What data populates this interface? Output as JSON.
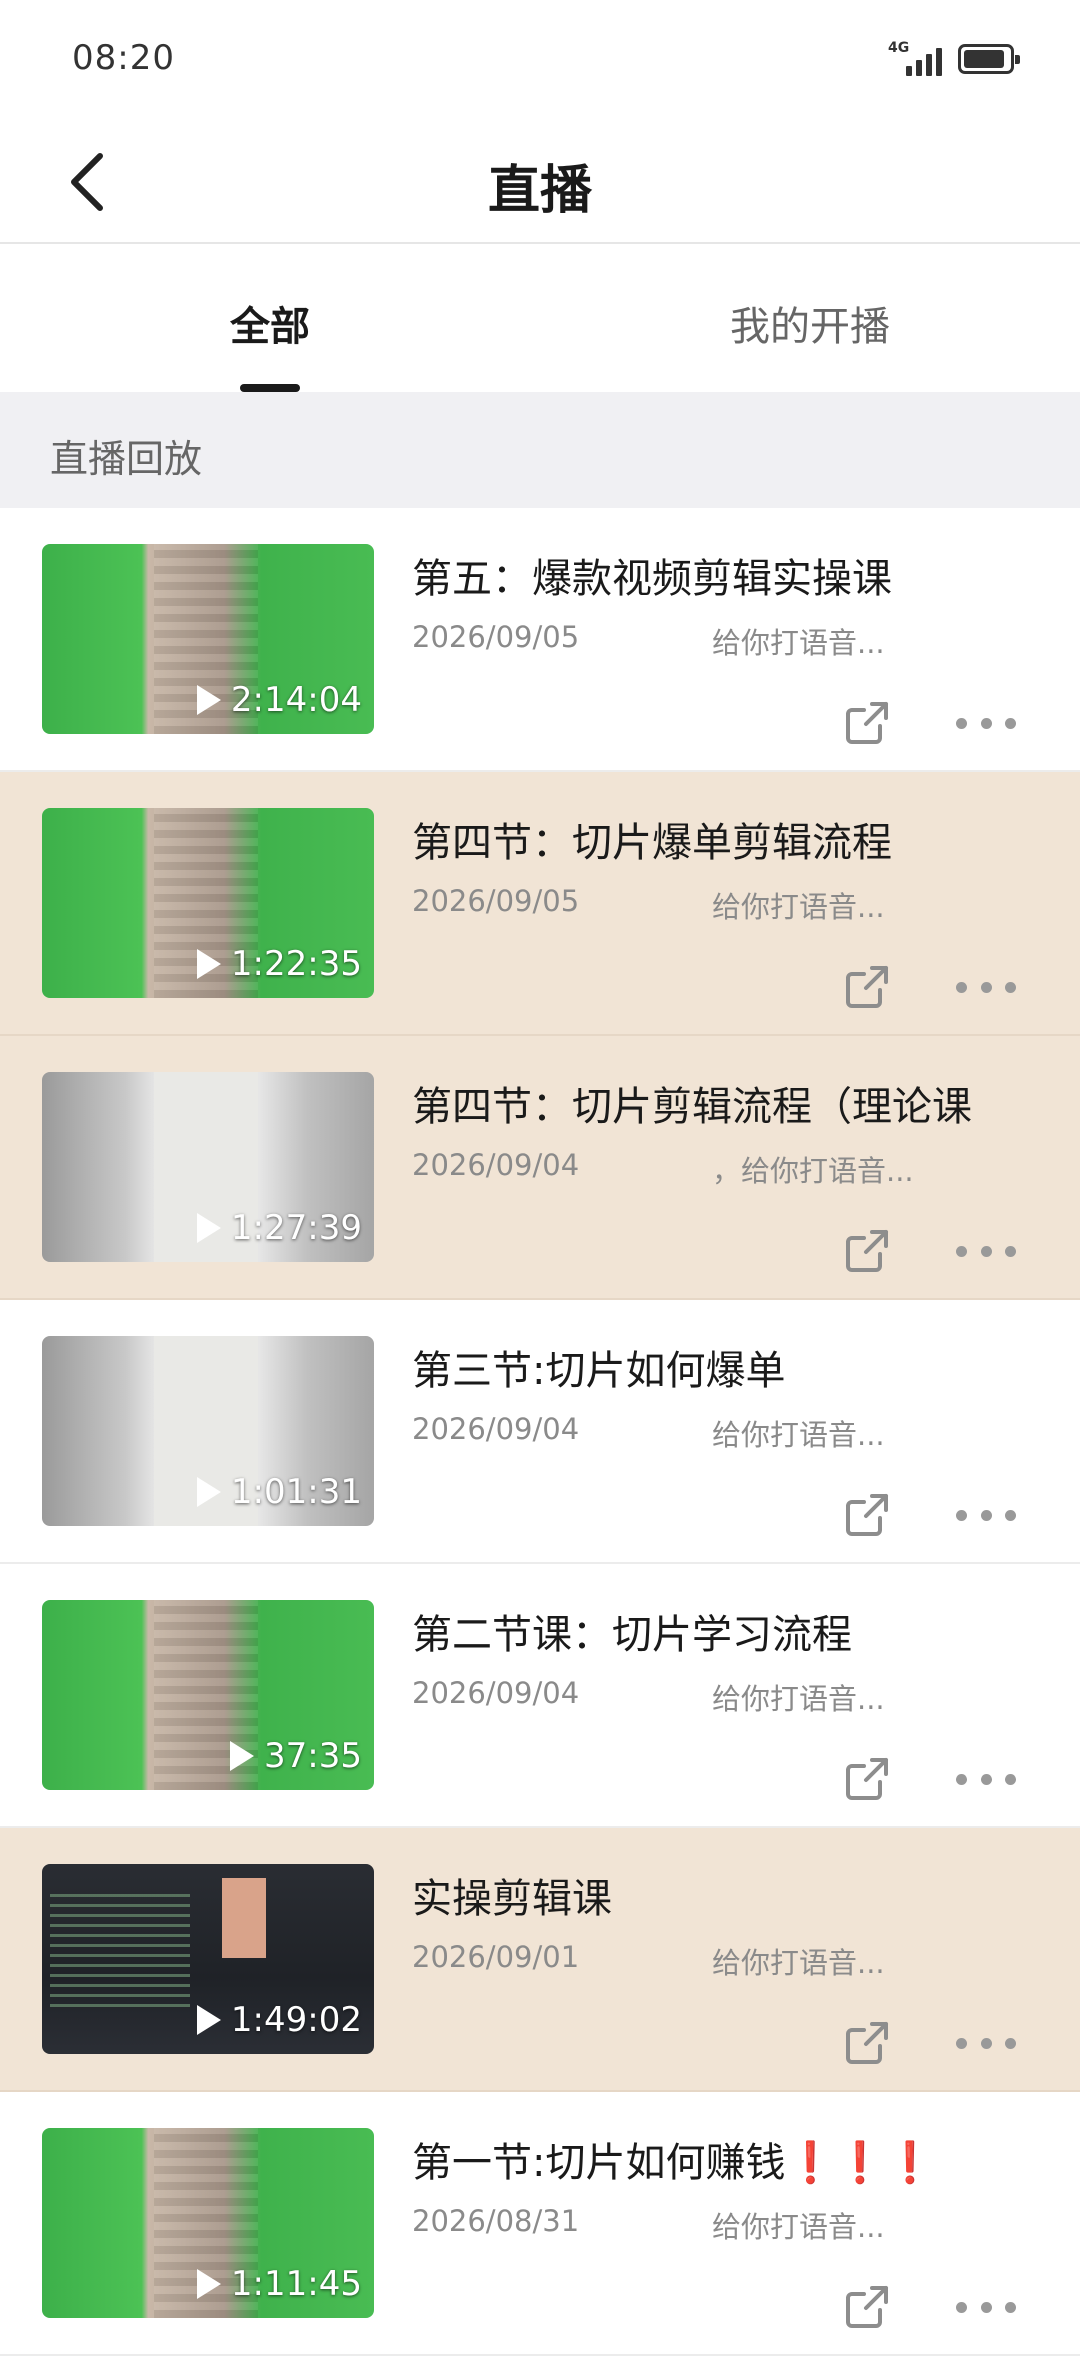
{
  "status_bar": {
    "time": "08:20",
    "network": "4G",
    "battery_level": 0.9
  },
  "header": {
    "title": "直播",
    "back_icon": "chevron-left-icon"
  },
  "tabs": [
    {
      "label": "全部",
      "active": true
    },
    {
      "label": "我的开播",
      "active": false
    }
  ],
  "section": {
    "title": "直播回放"
  },
  "items": [
    {
      "title": "第五：爆款视频剪辑实操课",
      "date": "2026/09/05",
      "host": "给你打语音...",
      "duration": "2:14:04",
      "thumb": "green",
      "highlight": false
    },
    {
      "title": "第四节：切片爆单剪辑流程",
      "date": "2026/09/05",
      "host": "给你打语音...",
      "duration": "1:22:35",
      "thumb": "green",
      "highlight": true
    },
    {
      "title": "第四节：切片剪辑流程（理论课",
      "date": "2026/09/04",
      "host": "，给你打语音...",
      "duration": "1:27:39",
      "thumb": "gray",
      "highlight": true
    },
    {
      "title": "第三节:切片如何爆单",
      "date": "2026/09/04",
      "host": "给你打语音...",
      "duration": "1:01:31",
      "thumb": "gray",
      "highlight": false
    },
    {
      "title": "第二节课：切片学习流程",
      "date": "2026/09/04",
      "host": "给你打语音...",
      "duration": "37:35",
      "thumb": "green",
      "highlight": false
    },
    {
      "title": "实操剪辑课",
      "date": "2026/09/01",
      "host": "给你打语音...",
      "duration": "1:49:02",
      "thumb": "dark",
      "highlight": true
    },
    {
      "title": "第一节:切片如何赚钱❗❗❗",
      "date": "2026/08/31",
      "host": "给你打语音...",
      "duration": "1:11:45",
      "thumb": "green",
      "highlight": false
    }
  ],
  "icons": {
    "play": "play-icon",
    "share": "share-external-icon",
    "more": "more-dots-icon"
  },
  "colors": {
    "highlight_row": "#f1e4d5",
    "section_bg": "#f0f0f3",
    "text_primary": "#1a1a1a",
    "text_secondary": "#8a8a8a"
  }
}
